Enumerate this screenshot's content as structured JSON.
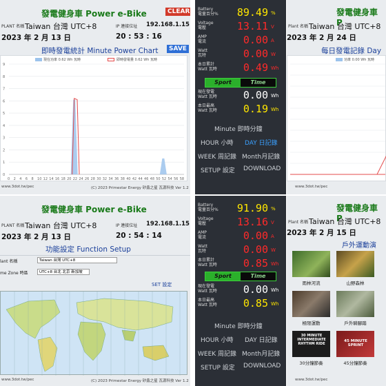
{
  "colors": {
    "green_title": "#1a7a1a",
    "yellow": "#ffe600",
    "red": "#ff2a2a",
    "white": "#ffffff",
    "blue_accent": "#2e6fd6",
    "bar_blue": "#9cc3ec",
    "bar_red": "#e44b4b"
  },
  "tl": {
    "title": "發電健身車   Power e-Bike",
    "clear": "CLEAR",
    "place_label": "PLANT 名稱",
    "place": "Taiwan 台灣 UTC+8",
    "ip_label": "IP 連接位址",
    "ip": "192.168.1.15",
    "date": "2023 年 2 月 13 日",
    "time": "20 : 53 : 16",
    "subtitle": "即時發電統計   Minute Power Chart",
    "save": "SAVE",
    "legend": [
      "現在功率 0.62 Wh 瓦時",
      "即時發電量 0.62 Wh 瓦時"
    ],
    "footer_left": "www.3dot.tw/pec",
    "footer_right": "(C) 2023 Primestar Energy 矽鑫之星 瓦源科技  Ver 1.2"
  },
  "chart_data": {
    "type": "bar",
    "x_ticks": [
      "0",
      "2",
      "4",
      "6",
      "8",
      "10",
      "12",
      "14",
      "16",
      "18",
      "20",
      "22",
      "24",
      "26",
      "28",
      "30",
      "32",
      "34",
      "36",
      "38",
      "40",
      "42",
      "44",
      "46",
      "48",
      "50",
      "52",
      "54",
      "56",
      "58"
    ],
    "y_ticks": [
      "0",
      "1",
      "2",
      "3",
      "4",
      "5",
      "6",
      "7",
      "8",
      "9"
    ],
    "ylim": [
      0,
      9
    ],
    "series": [
      {
        "name": "現在功率 0.62 Wh 瓦時",
        "points": [
          {
            "x": 22,
            "y": 6.1
          },
          {
            "x": 52,
            "y": 1.3
          }
        ]
      },
      {
        "name": "即時發電量 0.62 Wh 瓦時",
        "points": [
          {
            "x": 22,
            "y": 6.2
          },
          {
            "x": 23,
            "y": 6.1
          }
        ]
      }
    ]
  },
  "tm": {
    "rows": [
      {
        "l1": "Battery",
        "l2": "電量百分%",
        "value": "89.49",
        "unit": "%",
        "color": "#ffe600"
      },
      {
        "l1": "Voltage",
        "l2": "電壓",
        "value": "13.11",
        "unit": "V",
        "color": "#ff2a2a"
      },
      {
        "l1": "AMP",
        "l2": "電流",
        "value": "0.00",
        "unit": "A",
        "color": "#ff2a2a"
      },
      {
        "l1": "Watt",
        "l2": "瓦特",
        "value": "0.00",
        "unit": "W",
        "color": "#ff2a2a"
      },
      {
        "l1": "本日累計",
        "l2": "Watt 瓦時",
        "value": "0.49",
        "unit": "Wh",
        "color": "#ff2a2a"
      }
    ],
    "sport_a": "Sport",
    "sport_b": "Time",
    "rows2": [
      {
        "l1": "現在發電",
        "l2": "Watt 瓦時",
        "value": "0.00",
        "unit": "Wh",
        "color": "#ffffff"
      },
      {
        "l1": "本日最高",
        "l2": "Watt 瓦時",
        "value": "0.19",
        "unit": "Wh",
        "color": "#ffe600"
      }
    ],
    "menu": {
      "minute": "Minute 即時分鐘",
      "hour": "HOUR 小時",
      "day": "DAY 日記錄",
      "week": "WEEK 周記錄",
      "month": "Month月記錄",
      "setup": "SETUP 設定",
      "download": "DOWNLOAD"
    }
  },
  "tr": {
    "title": "發電健身車   P",
    "place_label": "Plant 名稱",
    "place": "Taiwan 台灣 UTC+8",
    "date": "2023 年 2 月 24 日",
    "subtitle": "每日發電記錄   Day",
    "legend": "功率 0.00 Wh 瓦時",
    "footer": "www.3dot.tw/pec"
  },
  "bl": {
    "title": "發電健身車   Power e-Bike",
    "place_label": "PLANT 名稱",
    "place": "Taiwan 台灣 UTC+8",
    "ip_label": "IP 連接位址",
    "ip": "192.168.1.15",
    "date": "2023 年 2 月 13 日",
    "time": "20 : 54 : 14",
    "subtitle": "功能設定   Function Setup",
    "plant_label": "lant 名稱",
    "plant_value": "Taiwan 台灣 UTC+8",
    "zone_label": "me Zone 時區",
    "zone_value": "UTC+8 台北 北京 新加坡",
    "set_label": "SET  設定",
    "footer_left": "www.3dot.tw/pec",
    "footer_right": "(C) 2023 Primestar Energy 矽鑫之星 瓦源科技  Ver 1.2"
  },
  "bm": {
    "rows": [
      {
        "l1": "Battery",
        "l2": "電量百分%",
        "value": "91.90",
        "unit": "%",
        "color": "#ffe600"
      },
      {
        "l1": "Voltage",
        "l2": "電壓",
        "value": "13.16",
        "unit": "V",
        "color": "#ff2a2a"
      },
      {
        "l1": "AMP",
        "l2": "電流",
        "value": "0.00",
        "unit": "A",
        "color": "#ff2a2a"
      },
      {
        "l1": "Watt",
        "l2": "瓦特",
        "value": "0.00",
        "unit": "W",
        "color": "#ff2a2a"
      },
      {
        "l1": "本日累計",
        "l2": "Watt 瓦時",
        "value": "0.85",
        "unit": "Wh",
        "color": "#ff2a2a"
      }
    ],
    "sport_a": "Sport",
    "sport_b": "Time",
    "rows2": [
      {
        "l1": "現在發電",
        "l2": "Watt 瓦時",
        "value": "0.00",
        "unit": "Wh",
        "color": "#ffffff"
      },
      {
        "l1": "本日最高",
        "l2": "Watt 瓦時",
        "value": "0.85",
        "unit": "Wh",
        "color": "#ffe600"
      }
    ],
    "menu": {
      "minute": "Minute 即時分鐘",
      "hour": "HOUR 小時",
      "day": "DAY 日記錄",
      "week": "WEEK 周記錄",
      "month": "Month月記錄",
      "setup": "SETUP 設定",
      "download": "DOWNLOAD"
    }
  },
  "br": {
    "title": "發電健身車   P",
    "place_label": "Plant 名稱",
    "place": "Taiwan 台灣 UTC+8",
    "date": "2023 年 2 月 15 日",
    "subtitle": "戶外運動演",
    "videos": [
      {
        "caption": "雨林河流"
      },
      {
        "caption": "山野森林"
      },
      {
        "caption": "極限運動"
      },
      {
        "caption": "戶外騎腳踏"
      },
      {
        "caption": "30分鐘節奏",
        "overlay": "30 MINUTE INTERMEDIATE RHYTHM RIDE"
      },
      {
        "caption": "45分鐘節奏",
        "overlay": "45 MINUTE SPRINT"
      }
    ],
    "footer": "www.3dot.tw/pec"
  }
}
